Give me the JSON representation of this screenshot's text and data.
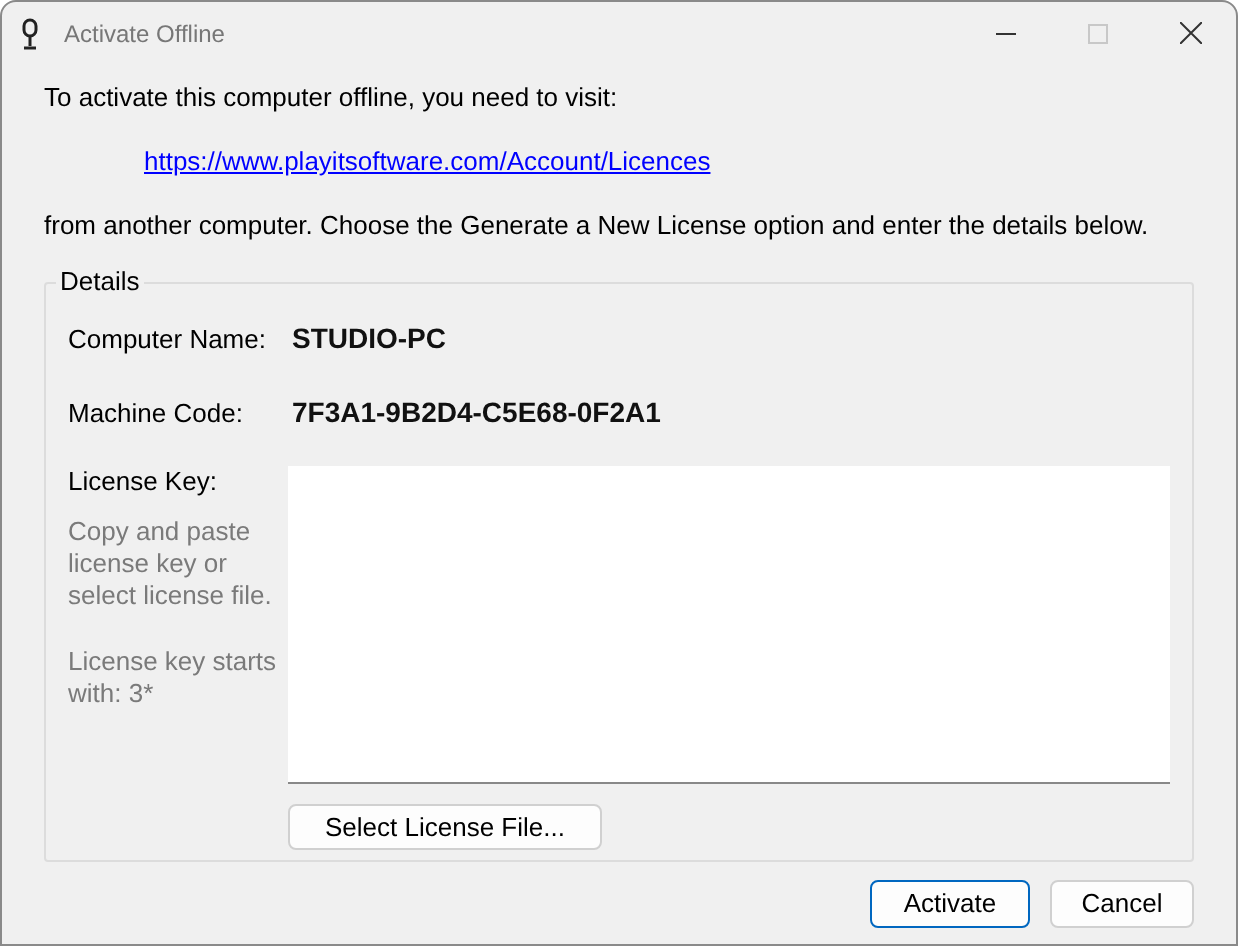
{
  "window": {
    "title": "Activate Offline",
    "controls": [
      {
        "kind": "minimize",
        "disabled": false
      },
      {
        "kind": "maximize",
        "disabled": true
      },
      {
        "kind": "close",
        "disabled": false
      }
    ]
  },
  "intro": "To activate this computer offline, you need to visit:",
  "link": "https://www.playitsoftware.com/Account/Licences",
  "instructions": "from another computer. Choose the Generate a New License option and enter the details below.",
  "details": {
    "title": "Details",
    "fields": [
      {
        "label": "Computer Name:",
        "value": "STUDIO-PC"
      },
      {
        "label": "Machine Code:",
        "value": "7F3A1-9B2D4-C5E68-0F2A1"
      }
    ],
    "license_key": {
      "label": "License Key:",
      "hints": [
        "Copy and paste license key or select license file.",
        "License key starts with: 3*"
      ]
    },
    "select_button": "Select License File..."
  },
  "buttons": [
    {
      "label": "Activate",
      "default": true
    },
    {
      "label": "Cancel",
      "default": false
    }
  ]
}
